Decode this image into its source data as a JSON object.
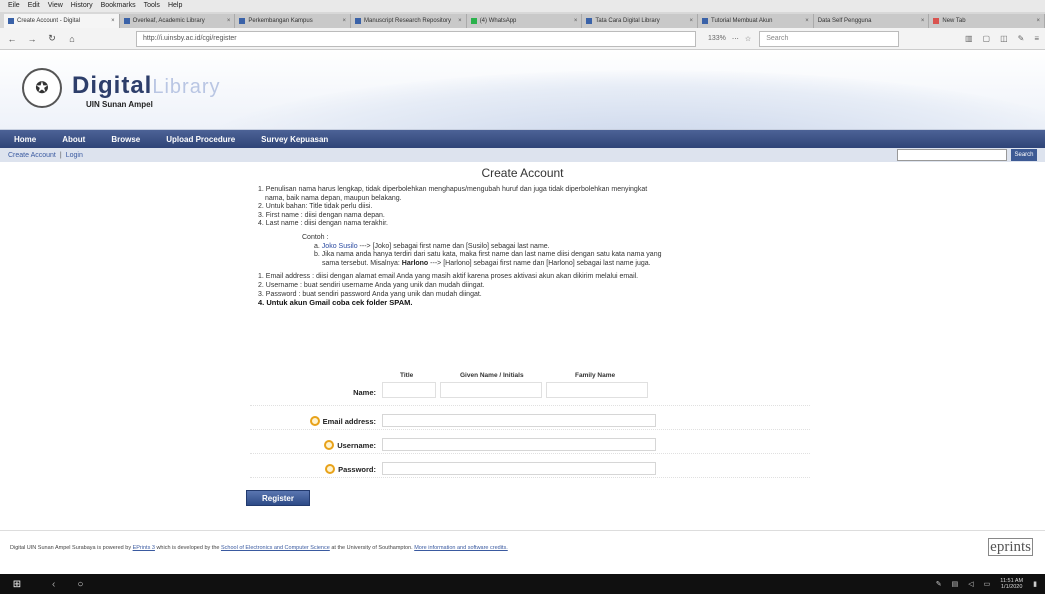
{
  "browser": {
    "menu": [
      "Eile",
      "Edit",
      "View",
      "History",
      "Bookmarks",
      "Tools",
      "Help"
    ],
    "tabs": [
      {
        "title": "Create Account - Digital",
        "active": true
      },
      {
        "title": "Overleaf, Academic Library",
        "active": false
      },
      {
        "title": "Perkembangan Kampus",
        "active": false
      },
      {
        "title": "Manuscript Research Repository",
        "active": false
      },
      {
        "title": "(4) WhatsApp",
        "active": false
      },
      {
        "title": "Tata Cara Digital Library",
        "active": false
      },
      {
        "title": "Tutorial Membuat Akun",
        "active": false
      },
      {
        "title": "Data Self Pengguna",
        "active": false
      },
      {
        "title": "New Tab",
        "active": false
      }
    ],
    "url": "http://i.uinsby.ac.id/cgi/register",
    "zoom": "133%",
    "search_placeholder": "Search"
  },
  "site": {
    "logo_main": "Digital",
    "logo_light": "Library",
    "logo_sub": "UIN Sunan Ampel",
    "nav": [
      "Home",
      "About",
      "Browse",
      "Upload Procedure",
      "Survey Kepuasan"
    ],
    "subnav": {
      "create": "Create Account",
      "login": "Login"
    },
    "search_button": "Search"
  },
  "page": {
    "title": "Create Account",
    "instructions_1": [
      "1. Penulisan nama harus lengkap, tidak diperbolehkan menghapus/mengubah huruf dan juga tidak diperbolehkan menyingkat",
      "nama, baik nama depan, maupun belakang.",
      "2. Untuk bahan: Title tidak perlu diisi.",
      "3. First name : diisi dengan nama depan.",
      "4. Last name : diisi dengan nama terakhir."
    ],
    "example_label": "Contoh :",
    "example_a_pre": "a. ",
    "example_a_name": "Joko Susilo",
    "example_a_arrow": " ---> ",
    "example_a_rest": "[Joko] sebagai first name dan [Susilo] sebagai last name.",
    "example_b_line1": "b. Jika nama anda hanya terdiri dari satu kata, maka first name dan last name diisi dengan satu kata nama yang",
    "example_b_line2_pre": "sama tersebut. Misalnya: ",
    "example_b_name": "Harlono",
    "example_b_line2_rest": " ---> [Harlono] sebagai first name dan [Harlono] sebagai last name juga.",
    "instructions_2": [
      "1. Email address : diisi dengan alamat email Anda yang masih aktif karena proses aktivasi akun akan dikirim melalui email.",
      "2. Username : buat sendiri username Anda yang unik dan mudah diingat.",
      "3. Password : buat sendiri password Anda yang unik dan mudah diingat."
    ],
    "gmail_note": "4. Untuk akun Gmail coba cek folder SPAM.",
    "form": {
      "name_label": "Name:",
      "col_title": "Title",
      "col_given": "Given Name / Initials",
      "col_family": "Family Name",
      "email_label": "Email address:",
      "username_label": "Username:",
      "password_label": "Password:",
      "register_button": "Register"
    }
  },
  "footer": {
    "text_pre": "Digital UIN Sunan Ampel Surabaya is powered by ",
    "link_eprints": "EPrints 3",
    "text_mid": " which is developed by the ",
    "link_school": "School of Electronics and Computer Science",
    "text_post": " at the University of Southampton. ",
    "link_more": "More information and software credits.",
    "logo": "eprints"
  },
  "taskbar": {
    "time": "11:51 AM",
    "date": "1/1/2020"
  }
}
